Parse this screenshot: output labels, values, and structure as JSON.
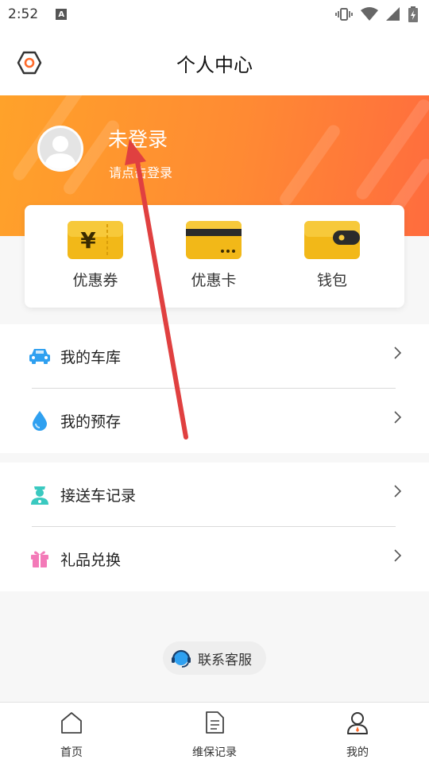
{
  "status_bar": {
    "time": "2:52",
    "notification_badge": "A"
  },
  "header": {
    "title": "个人中心"
  },
  "profile": {
    "name": "未登录",
    "hint": "请点击登录"
  },
  "wallet": [
    {
      "label": "优惠券",
      "icon": "coupon-icon"
    },
    {
      "label": "优惠卡",
      "icon": "card-icon"
    },
    {
      "label": "钱包",
      "icon": "wallet-icon"
    }
  ],
  "menu_group_1": [
    {
      "label": "我的车库",
      "icon": "car-icon"
    },
    {
      "label": "我的预存",
      "icon": "water-drop-icon"
    }
  ],
  "menu_group_2": [
    {
      "label": "接送车记录",
      "icon": "driver-icon"
    },
    {
      "label": "礼品兑换",
      "icon": "gift-icon"
    }
  ],
  "contact": {
    "label": "联系客服"
  },
  "bottom_nav": [
    {
      "label": "首页",
      "icon": "home-icon",
      "active": false
    },
    {
      "label": "维保记录",
      "icon": "document-icon",
      "active": false
    },
    {
      "label": "我的",
      "icon": "user-icon",
      "active": true
    }
  ],
  "colors": {
    "accent_orange": "#ff8a33",
    "gold": "#f2b818",
    "car_blue": "#2fa0f0",
    "gift_pink": "#f37ab8",
    "driver_teal": "#3ac9c0",
    "arrow_red": "#e04040"
  }
}
